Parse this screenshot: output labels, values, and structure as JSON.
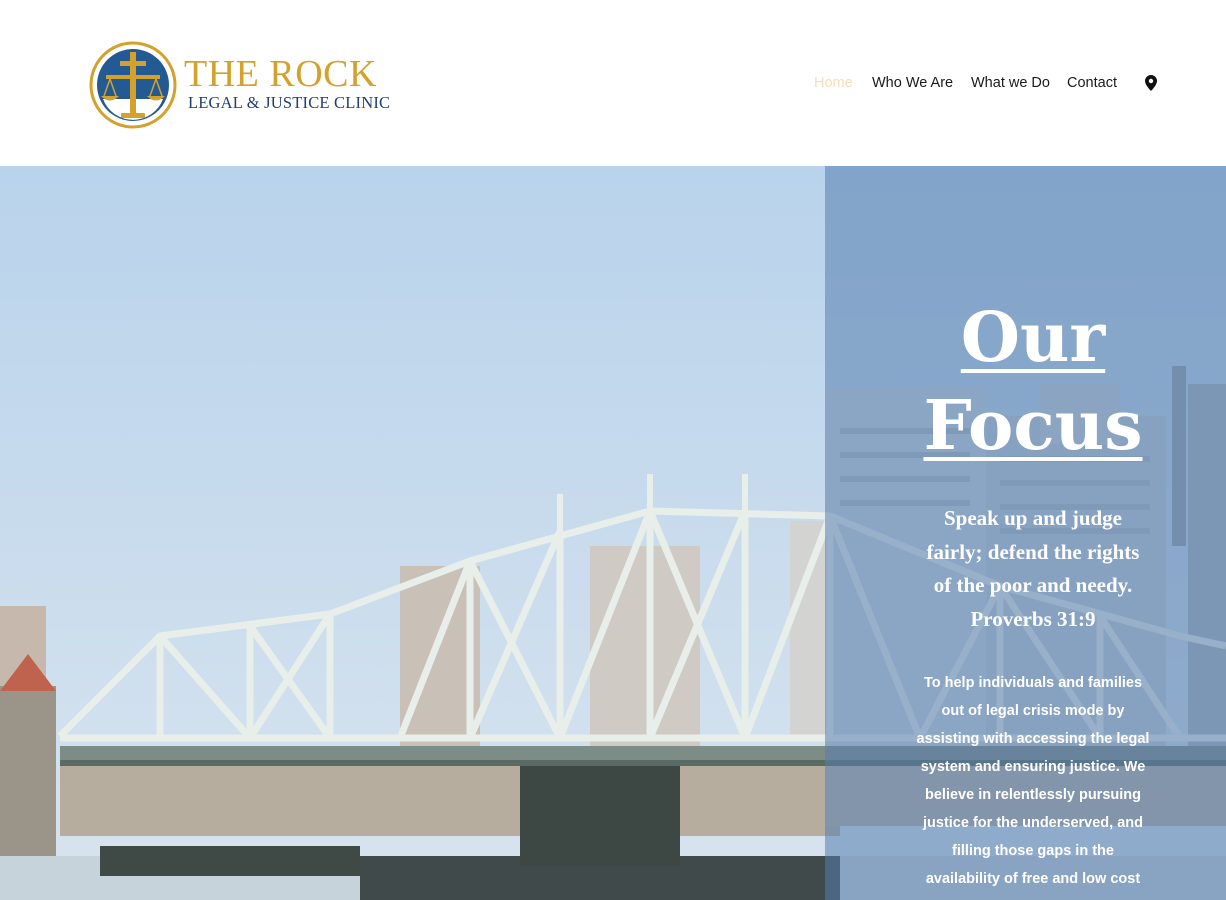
{
  "brand": {
    "title": "THE ROCK",
    "subtitle": "LEGAL & JUSTICE CLINIC",
    "emblem_icon": "scales-of-justice-cross-icon",
    "gold": "#d4a12c",
    "navy": "#1f3f75"
  },
  "nav": {
    "items": [
      {
        "label": "Home",
        "active": true
      },
      {
        "label": "Who We Are",
        "active": false
      },
      {
        "label": "What we Do",
        "active": false
      },
      {
        "label": "Contact",
        "active": false
      }
    ],
    "map_icon": "map-pin-icon",
    "active_color": "#f3cf9a"
  },
  "hero": {
    "background_icon": "bridge-photo",
    "heading_lines": [
      "Our",
      "Focus"
    ],
    "verse_lines": [
      "Speak up and judge",
      "fairly; defend the rights",
      "of the poor and needy.",
      "Proverbs 31:9"
    ],
    "mission_lines": [
      "To help individuals and families",
      "out of legal crisis mode by",
      "assisting with accessing the legal",
      "system and ensuring justice. We",
      "believe in relentlessly pursuing",
      "justice for the underserved, and",
      "filling those gaps in the",
      "availability of free and low cost"
    ]
  }
}
